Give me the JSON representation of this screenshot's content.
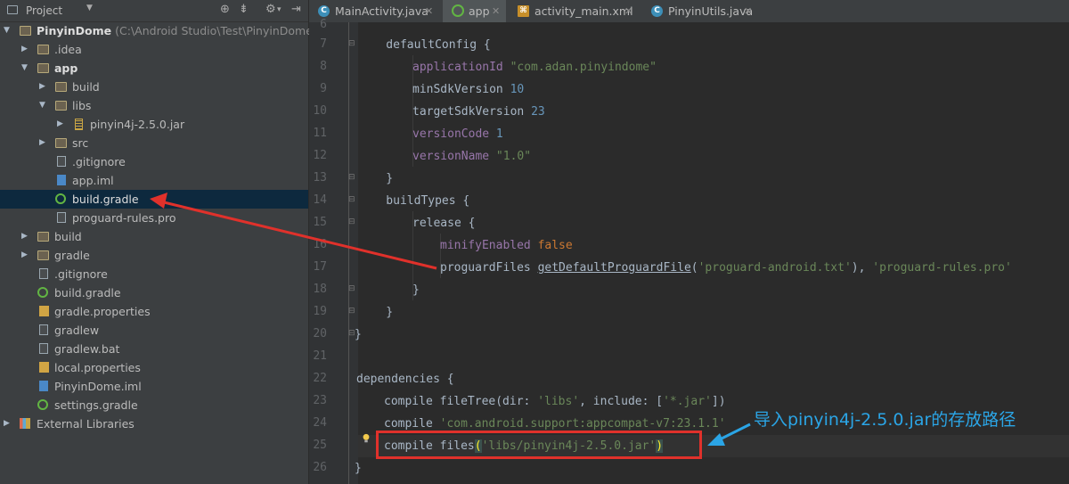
{
  "project_panel": {
    "title": "Project",
    "tree": [
      {
        "label": "PinyinDome",
        "path": "(C:\\Android Studio\\Test\\PinyinDome)",
        "bold": true
      },
      {
        "label": ".idea"
      },
      {
        "label": "app",
        "bold": true
      },
      {
        "label": "build"
      },
      {
        "label": "libs"
      },
      {
        "label": "pinyin4j-2.5.0.jar"
      },
      {
        "label": "src"
      },
      {
        "label": ".gitignore"
      },
      {
        "label": "app.iml"
      },
      {
        "label": "build.gradle",
        "selected": true
      },
      {
        "label": "proguard-rules.pro"
      },
      {
        "label": "build"
      },
      {
        "label": "gradle"
      },
      {
        "label": ".gitignore"
      },
      {
        "label": "build.gradle"
      },
      {
        "label": "gradle.properties"
      },
      {
        "label": "gradlew"
      },
      {
        "label": "gradlew.bat"
      },
      {
        "label": "local.properties"
      },
      {
        "label": "PinyinDome.iml"
      },
      {
        "label": "settings.gradle"
      },
      {
        "label": "External Libraries"
      }
    ]
  },
  "tabs": [
    {
      "label": "MainActivity.java",
      "icon": "class-icon"
    },
    {
      "label": "app",
      "icon": "gradle-icon",
      "active": true
    },
    {
      "label": "activity_main.xml",
      "icon": "xml-icon"
    },
    {
      "label": "PinyinUtils.java",
      "icon": "class-icon"
    }
  ],
  "editor": {
    "line_numbers": [
      "6",
      "7",
      "8",
      "9",
      "10",
      "11",
      "12",
      "13",
      "14",
      "15",
      "16",
      "17",
      "18",
      "19",
      "20",
      "21",
      "22",
      "23",
      "24",
      "25",
      "26"
    ],
    "code": {
      "l7": {
        "a": "    defaultConfig {"
      },
      "l8": {
        "prop": "applicationId",
        "str": "\"com.adan.pinyindome\""
      },
      "l9": {
        "a": "minSdkVersion ",
        "num": "10"
      },
      "l10": {
        "a": "targetSdkVersion ",
        "num": "23"
      },
      "l11": {
        "prop": "versionCode",
        "num": "1"
      },
      "l12": {
        "prop": "versionName",
        "str": "\"1.0\""
      },
      "l13": {
        "a": "    }"
      },
      "l14": {
        "a": "    buildTypes {"
      },
      "l15": {
        "a": "release {"
      },
      "l16": {
        "prop": "minifyEnabled",
        "kw": "false"
      },
      "l17": {
        "a": "proguardFiles ",
        "fn": "getDefaultProguardFile",
        "s1": "'proguard-android.txt'",
        "s2": "'proguard-rules.pro'"
      },
      "l18": {
        "a": "}"
      },
      "l19": {
        "a": "    }"
      },
      "l20": {
        "a": "}"
      },
      "l22": {
        "a": "dependencies {"
      },
      "l23": {
        "a": "compile fileTree(dir: ",
        "s1": "'libs'",
        "b": ", include: [",
        "s2": "'*.jar'",
        "c": "])"
      },
      "l24": {
        "a": "compile ",
        "s1": "'com.android.support:appcompat-v7:23.1.1'"
      },
      "l25": {
        "a": "compile files",
        "s1": "'libs/pinyin4j-2.5.0.jar'"
      },
      "l26": {
        "a": "}"
      }
    }
  },
  "annotation": {
    "text": "导入pinyin4j-2.5.0.jar的存放路径",
    "color": "#2ba5e6"
  },
  "colors": {
    "highlight_box": "#e0312b",
    "arrow": "#e0312b",
    "annotation_arrow": "#2ba5e6"
  }
}
